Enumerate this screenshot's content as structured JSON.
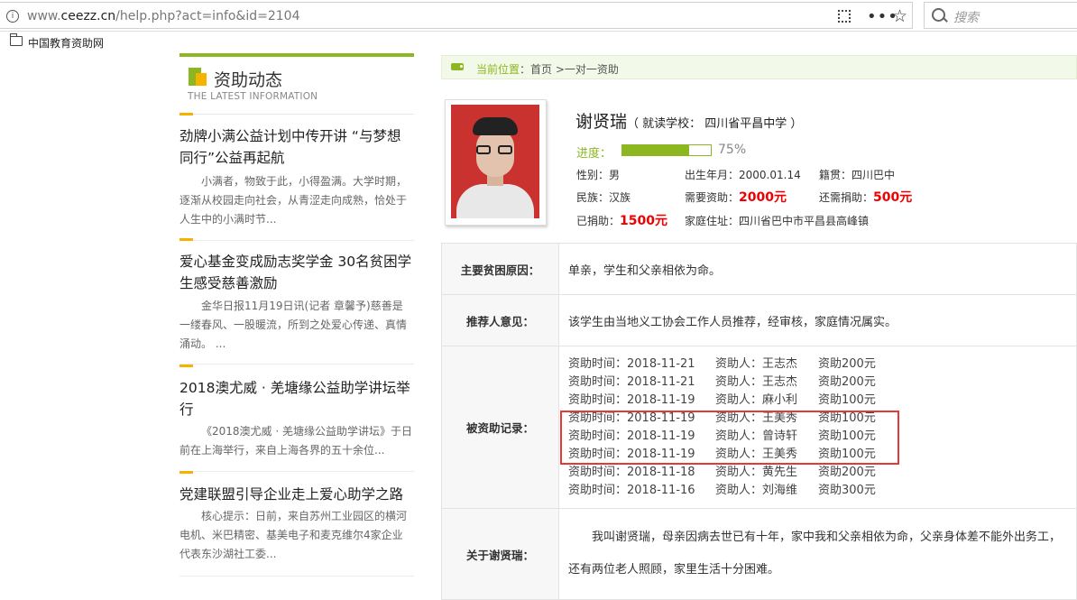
{
  "browser": {
    "url_prefix": "www.",
    "url_domain": "ceezz.cn",
    "url_path": "/help.php?act=info&id=2104",
    "search_placeholder": "搜索",
    "bookmark": "中国教育资助网"
  },
  "sidebar": {
    "title": "资助动态",
    "subtitle": "THE LATEST INFORMATION",
    "news": [
      {
        "title": "劲牌小满公益计划中传开讲 “与梦想同行”公益再起航",
        "desc": "小满者，物致于此，小得盈满。大学时期，逐渐从校园走向社会，从青涩走向成熟，恰处于人生中的小满时节..."
      },
      {
        "title": "爱心基金变成励志奖学金 30名贫困学生感受慈善激励",
        "desc": "金华日报11月19日讯(记者 章馨予)慈善是一缕春风、一股暖流，所到之处爱心传递、真情涌动。 ..."
      },
      {
        "title": "2018澳尤威 · 羌塘缘公益助学讲坛举行",
        "desc": "《2018澳尤威 · 羌塘缘公益助学讲坛》于日前在上海举行，来自上海各界的五十余位..."
      },
      {
        "title": "党建联盟引导企业走上爱心助学之路",
        "desc": "核心提示：日前，来自苏州工业园区的横河电机、米巴精密、基美电子和麦克维尔4家企业代表东沙湖社工委..."
      }
    ]
  },
  "breadcrumb": {
    "label": "当前位置",
    "path": "：首页 >一对一资助"
  },
  "student": {
    "name": "谢贤瑞",
    "school": "（ 就读学校： 四川省平昌中学 ）",
    "progress_label": "进度：",
    "progress": 0.75,
    "progress_text": "75%",
    "gender": "性别：男",
    "birth": "出生年月：2000.01.14",
    "native": "籍贯：四川巴中",
    "ethnicity": "民族：汉族",
    "need_label": "需要资助：",
    "need_value": "2000元",
    "still_label": "还需捐助：",
    "still_value": "500元",
    "donated_label": "已捐助：",
    "donated_value": "1500元",
    "address": "家庭住址：四川省巴中市平昌县高峰镇"
  },
  "details": {
    "reason_label": "主要贫困原因：",
    "reason": "单亲，学生和父亲相依为命。",
    "recommend_label": "推荐人意见：",
    "recommend": "该学生由当地义工协会工作人员推荐，经审核，家庭情况属实。",
    "records_label": "被资助记录：",
    "records": [
      {
        "time": "资助时间：2018-11-21",
        "person": "资助人：王志杰",
        "amount": "资助200元"
      },
      {
        "time": "资助时间：2018-11-21",
        "person": "资助人：王志杰",
        "amount": "资助200元"
      },
      {
        "time": "资助时间：2018-11-19",
        "person": "资助人：麻小利",
        "amount": "资助100元"
      },
      {
        "time": "资助时间：2018-11-19",
        "person": "资助人：王美秀",
        "amount": "资助100元"
      },
      {
        "time": "资助时间：2018-11-19",
        "person": "资助人：曾诗轩",
        "amount": "资助100元"
      },
      {
        "time": "资助时间：2018-11-19",
        "person": "资助人：王美秀",
        "amount": "资助100元"
      },
      {
        "time": "资助时间：2018-11-18",
        "person": "资助人：黄先生",
        "amount": "资助200元"
      },
      {
        "time": "资助时间：2018-11-16",
        "person": "资助人：刘海维",
        "amount": "资助300元"
      }
    ],
    "about_label": "关于谢贤瑞：",
    "about": "我叫谢贤瑞，母亲因病去世已有十年，家中我和父亲相依为命，父亲身体差不能外出务工，还有两位老人照顾，家里生活十分困难。"
  },
  "colors": {
    "accent": "#8cb720",
    "highlight": "#f5b300",
    "money": "#ee0000",
    "annotation": "#e53935"
  }
}
